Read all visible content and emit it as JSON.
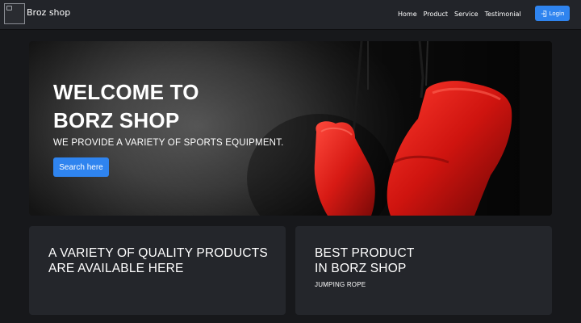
{
  "navbar": {
    "brand_name": "Broz shop",
    "links": [
      "Home",
      "Product",
      "Service",
      "Testimonial"
    ],
    "login_label": "Login",
    "login_icon": "login-icon",
    "accent": "#2f84ef"
  },
  "hero": {
    "title_line1": "WELCOME TO",
    "title_line2": "BORZ SHOP",
    "subtitle": "WE PROVIDE A VARIETY OF SPORTS EQUIPMENT.",
    "cta_label": "Search here",
    "image": "boxing-gloves-image"
  },
  "cards": {
    "left": {
      "title_line1": "A VARIETY OF QUALITY PRODUCTS",
      "title_line2": "ARE AVAILABLE HERE"
    },
    "right": {
      "title_line1": "BEST PRODUCT",
      "title_line2": "IN BORZ SHOP",
      "subtitle": "JUMPING ROPE"
    }
  }
}
